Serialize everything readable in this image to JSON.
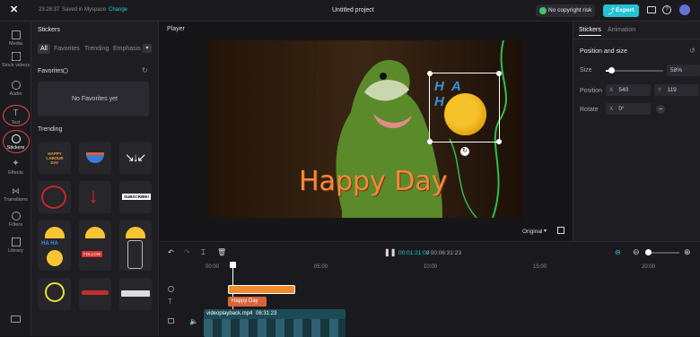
{
  "topbar": {
    "time": "23:28:37",
    "saved": "Saved in Myspace",
    "change": "Change",
    "project": "Untitled project",
    "copyright": "No copyright risk",
    "export": "Export"
  },
  "rail": [
    "Media",
    "Stock videos",
    "Audio",
    "Text",
    "Stickers",
    "Effects",
    "Transitions",
    "Filters",
    "Library"
  ],
  "panel": {
    "title": "Stickers",
    "tabs": [
      "All",
      "Favorites",
      "Trending",
      "Emphasis"
    ],
    "favorites_label": "Favorites",
    "favorites_empty": "No Favorites yet",
    "trending_label": "Trending",
    "stickers": [
      "HAPPY LABOUR DAY",
      "FOOD BOWL",
      "ARROWS",
      "CIRCLE",
      "RED ARROW",
      "SUBSCRIBE!",
      "WINK EMOJI",
      "DIZZY EMOJI",
      "TONGUE EMOJI",
      "HA HA EMOJI",
      "FOLLOW",
      "PHONE",
      "SPARK",
      "RED SCRIBBLE",
      "SUBSCRIBE BAR"
    ]
  },
  "player": {
    "title": "Player",
    "caption": "Happy Day",
    "sticker_text": "HA HA",
    "ratio": "Original"
  },
  "props": {
    "tabs": [
      "Stickers",
      "Animation"
    ],
    "section": "Position and size",
    "size_label": "Size",
    "size_value": "58%",
    "position_label": "Position",
    "x_label": "X",
    "x_value": "540",
    "y_label": "Y",
    "y_value": "119",
    "rotate_label": "Rotate",
    "rotate_prefix": "X",
    "rotate_value": "0°"
  },
  "timeline": {
    "current": "00:01:21:08",
    "duration": "/ 00:06:31:23",
    "ticks": [
      "00:00",
      "05:00",
      "10:00",
      "15:00",
      "20:00"
    ],
    "text_clip": "Happy Day",
    "video_clip": "videoplayback.mp4",
    "video_duration": "06:31:23"
  },
  "colors": {
    "accent": "#21c8d6",
    "caption": "#f28a3a",
    "export": "#25c2d3"
  }
}
